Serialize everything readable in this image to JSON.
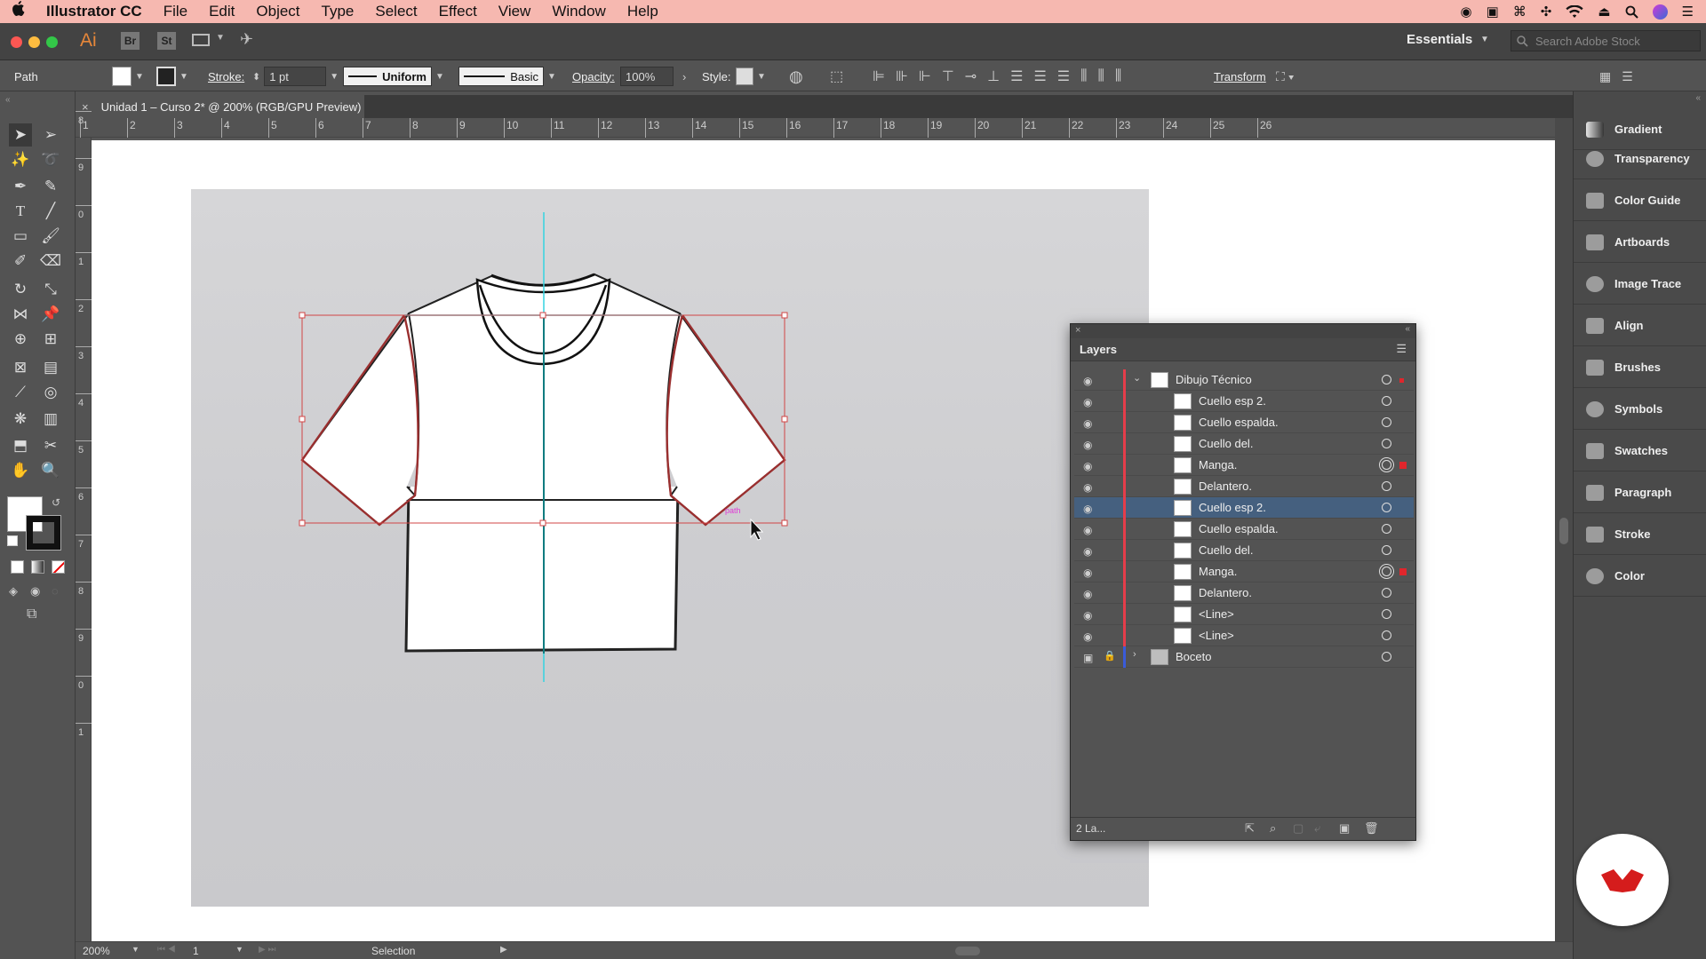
{
  "menubar": {
    "apple_icon": "apple-icon",
    "app_name": "Illustrator CC",
    "items": [
      "File",
      "Edit",
      "Object",
      "Type",
      "Select",
      "Effect",
      "View",
      "Window",
      "Help"
    ]
  },
  "titlebar": {
    "ai_label": "Ai",
    "br_label": "Br",
    "st_label": "St",
    "workspace": "Essentials",
    "search_placeholder": "Search Adobe Stock"
  },
  "controlbar": {
    "object_type": "Path",
    "stroke_label": "Stroke:",
    "stroke_weight": "1 pt",
    "profile_label": "Uniform",
    "brush_label": "Basic",
    "opacity_label": "Opacity:",
    "opacity_value": "100%",
    "style_label": "Style:",
    "transform_label": "Transform"
  },
  "document": {
    "tab_title": "Unidad 1 – Curso 2* @ 200% (RGB/GPU Preview)",
    "close_label": "×"
  },
  "ruler_h": [
    "1",
    "2",
    "3",
    "4",
    "5",
    "6",
    "7",
    "8",
    "9",
    "10",
    "11",
    "12",
    "13",
    "14",
    "15",
    "16",
    "17",
    "18",
    "19",
    "20",
    "21",
    "22",
    "23",
    "24",
    "25",
    "26"
  ],
  "ruler_v": [
    "8",
    "9",
    "0",
    "1",
    "2",
    "3",
    "4",
    "5",
    "6",
    "7",
    "8",
    "9",
    "0",
    "1"
  ],
  "layers_panel": {
    "title": "Layers",
    "rows": [
      {
        "name": "Dibujo Técnico",
        "level": 0,
        "expanded": true,
        "selected": false,
        "target": "single",
        "selection_mark": true
      },
      {
        "name": "Cuello esp 2.",
        "level": 1,
        "selected": false,
        "target": "single",
        "selection_mark": false
      },
      {
        "name": "Cuello espalda.",
        "level": 1,
        "selected": false,
        "target": "single",
        "selection_mark": false
      },
      {
        "name": "Cuello del.",
        "level": 1,
        "selected": false,
        "target": "single",
        "selection_mark": false
      },
      {
        "name": "Manga.",
        "level": 1,
        "selected": false,
        "target": "double",
        "selection_mark": true
      },
      {
        "name": "Delantero.",
        "level": 1,
        "selected": false,
        "target": "single",
        "selection_mark": false
      },
      {
        "name": "Cuello esp 2.",
        "level": 1,
        "selected": true,
        "target": "single",
        "selection_mark": false
      },
      {
        "name": "Cuello espalda.",
        "level": 1,
        "selected": false,
        "target": "single",
        "selection_mark": false
      },
      {
        "name": "Cuello del.",
        "level": 1,
        "selected": false,
        "target": "single",
        "selection_mark": false
      },
      {
        "name": "Manga.",
        "level": 1,
        "selected": false,
        "target": "double",
        "selection_mark": true
      },
      {
        "name": "Delantero.",
        "level": 1,
        "selected": false,
        "target": "single",
        "selection_mark": false
      },
      {
        "name": "<Line>",
        "level": 1,
        "selected": false,
        "target": "single",
        "selection_mark": false
      },
      {
        "name": "<Line>",
        "level": 1,
        "selected": false,
        "target": "single",
        "selection_mark": false
      },
      {
        "name": "Boceto",
        "level": 0,
        "expanded": false,
        "locked": true,
        "selected": false,
        "target": "single",
        "selection_mark": false
      }
    ],
    "footer_count": "2 La..."
  },
  "right_dock": [
    "Gradient",
    "Transparency",
    "Color Guide",
    "Artboards",
    "Image Trace",
    "Align",
    "Brushes",
    "Symbols",
    "Swatches",
    "Paragraph",
    "Stroke",
    "Color"
  ],
  "statusbar": {
    "zoom": "200%",
    "artboard_number": "1",
    "tool": "Selection"
  },
  "canvas": {
    "smart_guide_label": "path"
  },
  "colors": {
    "menubar_bg": "#f6b8b0",
    "selection_red": "#e0262c",
    "guide_cyan": "#35d3e0",
    "layer_color_red": "#e53d4a",
    "layer_color_blue": "#3a5bd9",
    "selected_row": "#45607f"
  }
}
